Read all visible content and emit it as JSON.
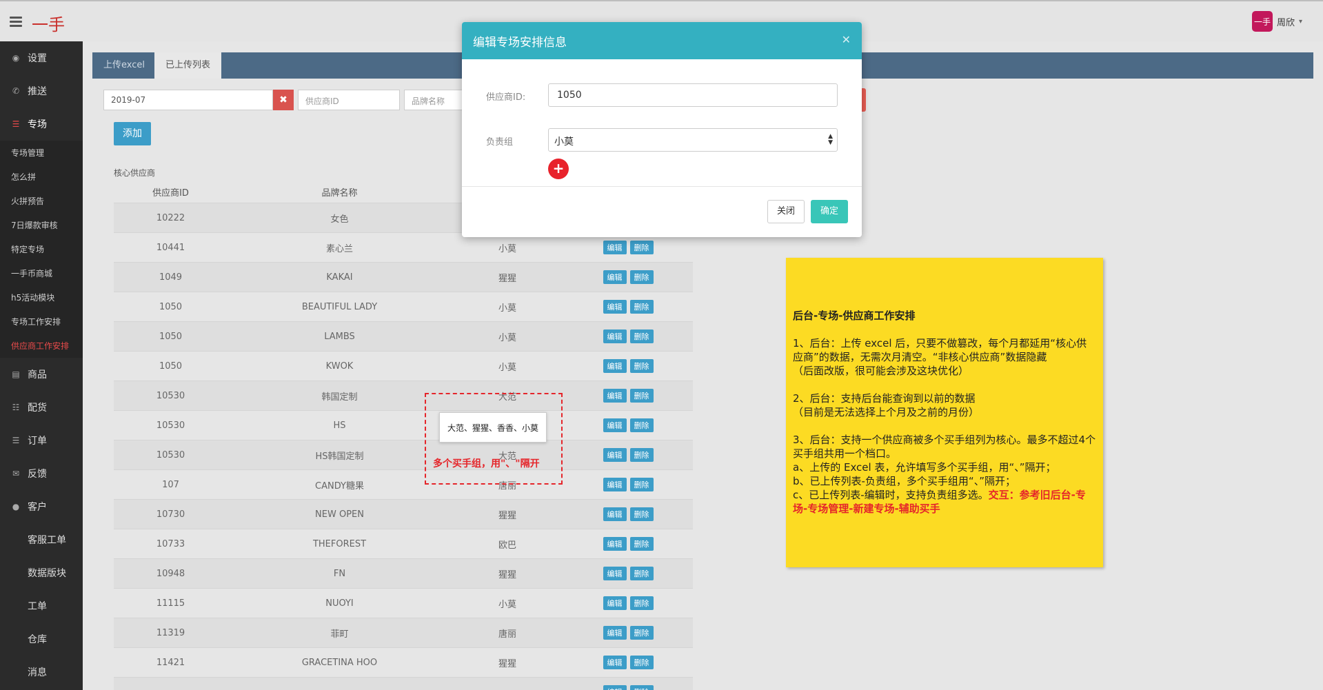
{
  "header": {
    "logo": "一手",
    "user_name": "周欣",
    "avatar_text": "一手"
  },
  "sidebar": {
    "top_items": [
      {
        "label": "设置",
        "icon": "dashboard-icon"
      },
      {
        "label": "推送",
        "icon": "phone-icon"
      }
    ],
    "section": {
      "label": "专场",
      "icon": "list-icon"
    },
    "sub_items": [
      "专场管理",
      "怎么拼",
      "火拼预告",
      "7日爆款审核",
      "特定专场",
      "一手币商城",
      "h5活动模块",
      "专场工作安排",
      "供应商工作安排"
    ],
    "active_sub": "供应商工作安排",
    "bottom_items": [
      {
        "label": "商品",
        "icon": "card-icon"
      },
      {
        "label": "配货",
        "icon": "list-icon"
      },
      {
        "label": "订单",
        "icon": "table-icon"
      },
      {
        "label": "反馈",
        "icon": "comments-icon"
      },
      {
        "label": "客户",
        "icon": "user-icon"
      }
    ],
    "plain_items": [
      "客服工单",
      "数据版块",
      "工单",
      "仓库",
      "消息"
    ]
  },
  "tabs": [
    "上传excel",
    "已上传列表"
  ],
  "filters": {
    "date": "2019-07",
    "supplier_placeholder": "供应商ID",
    "brand_placeholder": "品牌名称"
  },
  "add_button": "添加",
  "section_label": "核心供应商",
  "table": {
    "headers": {
      "id": "供应商ID",
      "brand": "品牌名称"
    },
    "op_edit": "编辑",
    "op_delete": "删除",
    "rows": [
      {
        "id": "10222",
        "brand": "女色",
        "group": ""
      },
      {
        "id": "10441",
        "brand": "素心兰",
        "group": "小莫"
      },
      {
        "id": "1049",
        "brand": "KAKAI",
        "group": "猩猩"
      },
      {
        "id": "1050",
        "brand": "BEAUTIFUL LADY",
        "group": "小莫"
      },
      {
        "id": "1050",
        "brand": "LAMBS",
        "group": "小莫"
      },
      {
        "id": "1050",
        "brand": "KWOK",
        "group": "小莫"
      },
      {
        "id": "10530",
        "brand": "韩国定制",
        "group": "大范"
      },
      {
        "id": "10530",
        "brand": "HS",
        "group": ""
      },
      {
        "id": "10530",
        "brand": "HS韩国定制",
        "group": "大范"
      },
      {
        "id": "107",
        "brand": "CANDY糖果",
        "group": "唐丽"
      },
      {
        "id": "10730",
        "brand": "NEW OPEN",
        "group": "猩猩"
      },
      {
        "id": "10733",
        "brand": "THEFOREST",
        "group": "欧巴"
      },
      {
        "id": "10948",
        "brand": "FN",
        "group": "猩猩"
      },
      {
        "id": "11115",
        "brand": "NUOYI",
        "group": "小莫"
      },
      {
        "id": "11319",
        "brand": "菲町",
        "group": "唐丽"
      },
      {
        "id": "11421",
        "brand": "GRACETINA HOO",
        "group": "猩猩"
      },
      {
        "id": "",
        "brand": "",
        "group": ""
      }
    ]
  },
  "annotation": {
    "tooltip": "大范、猩猩、香香、小莫",
    "note": "多个买手组，用\"、\"隔开"
  },
  "sticky_note": {
    "title": "后台-专场-供应商工作安排",
    "p1": "1、后台：上传 excel 后，只要不做篡改，每个月都延用“核心供应商”的数据，无需次月清空。“非核心供应商”数据隐藏\n（后面改版，很可能会涉及这块优化）",
    "p2": "2、后台：支持后台能查询到以前的数据\n（目前是无法选择上个月及之前的月份）",
    "p3_main": "3、后台：支持一个供应商被多个买手组列为核心。最多不超过4个买手组共用一个档口。\na、上传的 Excel 表，允许填写多个买手组，用“、”隔开；\nb、已上传列表-负责组，多个买手组用“、”隔开；\nc、已上传列表-编辑时，支持负责组多选。",
    "p3_red": "交互：参考旧后台-专场-专场管理-新建专场-辅助买手"
  },
  "modal": {
    "title": "编辑专场安排信息",
    "supplier_label": "供应商ID:",
    "supplier_value": "1050",
    "group_label": "负责组",
    "group_value": "小莫",
    "close_button": "关闭",
    "ok_button": "确定"
  },
  "colors": {
    "modal_header": "#34b0c1",
    "brand_red": "#c9302c",
    "note_yellow": "#fcdb23",
    "accent_blue": "#3c9dc8"
  }
}
